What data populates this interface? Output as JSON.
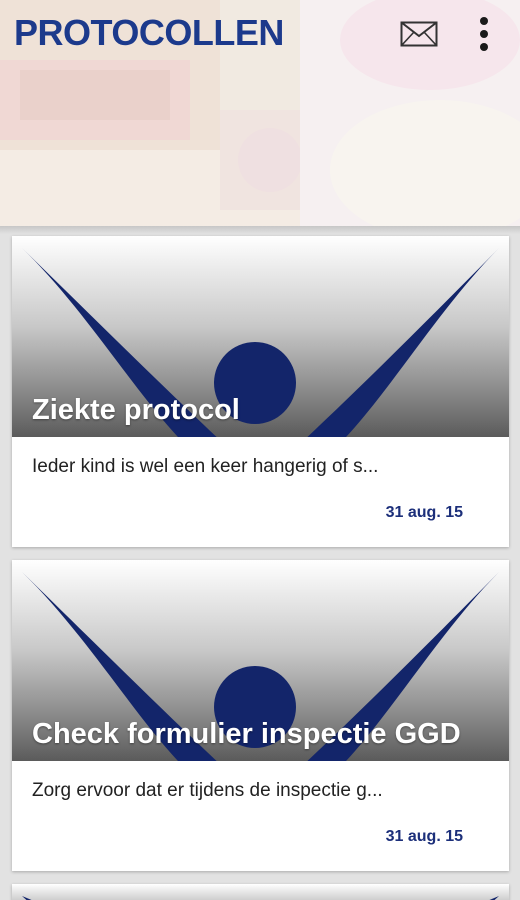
{
  "app": {
    "title": "PROTOCOLLEN",
    "accent_color": "#1c3a8c",
    "date_color": "#1c2f7a"
  },
  "toolbar": {
    "mail_icon": "envelope-icon",
    "menu_icon": "more-vert-icon"
  },
  "cards": [
    {
      "title": "Ziekte protocol",
      "excerpt": "Ieder kind is wel een keer hangerig of s...",
      "date": "31 aug. 15"
    },
    {
      "title": "Check formulier inspectie GGD",
      "excerpt": "Zorg ervoor dat er tijdens de inspectie g...",
      "date": "31 aug. 15"
    }
  ]
}
